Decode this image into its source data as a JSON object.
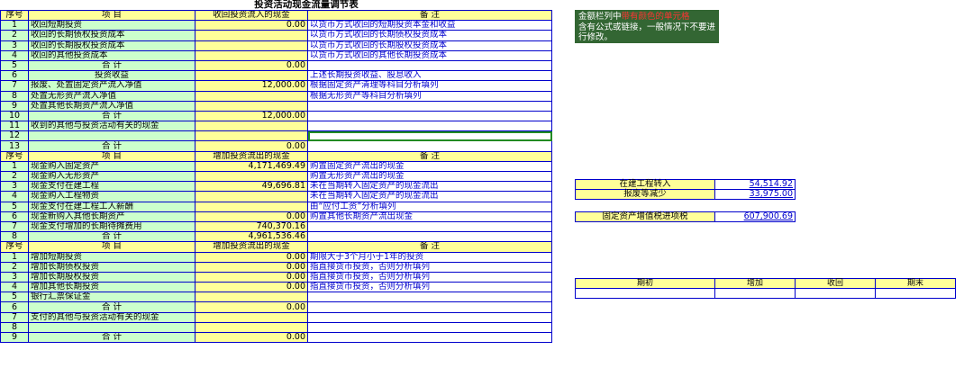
{
  "title": "投资活动现金流量调节表",
  "section1": {
    "headers": [
      "序号",
      "项    目",
      "收回投资流入的现金",
      "备       注"
    ],
    "rows": [
      {
        "n": "1",
        "item": "收回短期投资",
        "amount": "0.00",
        "note": "以货币方式收回的短期投资本金和收益"
      },
      {
        "n": "2",
        "item": "收回的长期债权投资成本",
        "amount": "",
        "note": "以货币方式收回的长期债权投资成本"
      },
      {
        "n": "3",
        "item": "收回的长期股权投资成本",
        "amount": "",
        "note": "以货币方式收回的长期股权投资成本"
      },
      {
        "n": "4",
        "item": "收回的其他投资成本",
        "amount": "",
        "note": "以货币方式收回的其他长期投资成本"
      },
      {
        "n": "5",
        "item": "合    计",
        "amount": "0.00",
        "note": "",
        "sub": true
      },
      {
        "n": "6",
        "item": "投资收益",
        "amount": "",
        "note": "上述长期投资收益、股息收入",
        "center": true
      },
      {
        "n": "7",
        "item": "报废、处置固定资产流入净值",
        "amount": "12,000.00",
        "note": "根据固定资产清理等科目分析填列"
      },
      {
        "n": "8",
        "item": "处置无形资产流入净值",
        "amount": "",
        "note": "根据无形资产等科目分析填列"
      },
      {
        "n": "9",
        "item": "处置其他长期资产流入净值",
        "amount": "",
        "note": ""
      },
      {
        "n": "10",
        "item": "合    计",
        "amount": "12,000.00",
        "note": "",
        "sub": true
      },
      {
        "n": "11",
        "item": "收到的其他与投资活动有关的现金",
        "amount": "",
        "note": ""
      },
      {
        "n": "12",
        "item": "",
        "amount": "",
        "note": ""
      },
      {
        "n": "13",
        "item": "合    计",
        "amount": "0.00",
        "note": "",
        "sub": true
      }
    ]
  },
  "section2": {
    "headers": [
      "序号",
      "项    目",
      "增加投资流出的现金",
      "备       注"
    ],
    "rows": [
      {
        "n": "1",
        "item": "现金购入固定资产",
        "amount": "4,171,469.49",
        "note": "购置固定资产流出的现金"
      },
      {
        "n": "2",
        "item": "现金购入无形资产",
        "amount": "",
        "note": "购置无形资产流出的现金"
      },
      {
        "n": "3",
        "item": "现金支付在建工程",
        "amount": "49,696.81",
        "note": "未在当期转入固定资产的现金流出"
      },
      {
        "n": "4",
        "item": "现金购入工程物资",
        "amount": "",
        "note": "未在当期转入固定资产的现金流出"
      },
      {
        "n": "5",
        "item": "现金支付在建工程工人薪酬",
        "amount": "",
        "note": "由“应付工资”分析填列"
      },
      {
        "n": "6",
        "item": "现金新购入其他长期资产",
        "amount": "0.00",
        "note": "购置其他长期资产流出现金"
      },
      {
        "n": "7",
        "item": "现金支付增加的长期待摊费用",
        "amount": "740,370.16",
        "note": ""
      },
      {
        "n": "8",
        "item": "合    计",
        "amount": "4,961,536.46",
        "note": "",
        "sub": true
      }
    ]
  },
  "section3": {
    "headers": [
      "序号",
      "项    目",
      "增加投资流出的现金",
      "备       注"
    ],
    "rows": [
      {
        "n": "1",
        "item": "增加短期投资",
        "amount": "0.00",
        "note": "期限大于3个月小于1年的投资"
      },
      {
        "n": "2",
        "item": "增加长期债权投资",
        "amount": "0.00",
        "note": "指直接货币投资，否则分析填列"
      },
      {
        "n": "3",
        "item": "增加长期股权投资",
        "amount": "0.00",
        "note": "指直接货币投资，否则分析填列"
      },
      {
        "n": "4",
        "item": "增加其他长期投资",
        "amount": "0.00",
        "note": "指直接货币投资，否则分析填列"
      },
      {
        "n": "5",
        "item": "银行汇票保证金",
        "amount": "",
        "note": ""
      },
      {
        "n": "6",
        "item": "合    计",
        "amount": "0.00",
        "note": "",
        "sub": true
      },
      {
        "n": "7",
        "item": "支付的其他与投资活动有关的现金",
        "amount": "",
        "note": ""
      },
      {
        "n": "8",
        "item": "",
        "amount": "",
        "note": ""
      },
      {
        "n": "9",
        "item": "合    计",
        "amount": "0.00",
        "note": "",
        "sub": true
      }
    ]
  },
  "note_box": {
    "prefix": "金额栏列中",
    "highlight": "带有颜色的单元格",
    "suffix": "含有公式或链接，一般情况下不要进行修改。"
  },
  "side": {
    "cip_transfer_label": "在建工程转入",
    "cip_transfer_value": "54,514.92",
    "scrap_decrease_label": "报废等减少",
    "scrap_decrease_value": "33,975.00",
    "vat_label": "固定资产增值税进项税",
    "vat_value": "607,900.69"
  },
  "history_headers": [
    "期初",
    "增加",
    "收回",
    "期末"
  ]
}
